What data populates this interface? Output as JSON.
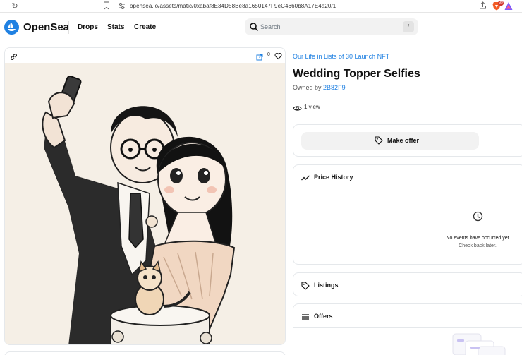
{
  "browser": {
    "url": "opensea.io/assets/matic/0xabaf8E34D58Be8a1650147F9eC4660b8A17E4a20/1",
    "extension_badge": "99",
    "icons": [
      "refresh-icon",
      "bookmark-icon",
      "site-settings-icon",
      "share-icon",
      "brave-icon",
      "alert-icon"
    ]
  },
  "header": {
    "logo_text": "OpenSea",
    "nav": {
      "drops": "Drops",
      "stats": "Stats",
      "create": "Create"
    },
    "search_placeholder": "Search",
    "search_shortcut": "/"
  },
  "media": {
    "favorite_count": "0",
    "icons": [
      "link-icon",
      "open-external-icon",
      "heart-icon"
    ]
  },
  "asset": {
    "collection": "Our Life in Lists of 30 Launch NFT",
    "title": "Wedding Topper Selfies",
    "owned_by_label": "Owned by",
    "owner": "2B82F9",
    "views": "1 view"
  },
  "offer": {
    "make_offer_label": "Make offer"
  },
  "price_history": {
    "label": "Price History",
    "empty_title": "No events have occurred yet",
    "empty_subtitle": "Check back later."
  },
  "listings": {
    "label": "Listings"
  },
  "offers": {
    "label": "Offers"
  },
  "colors": {
    "brand_blue": "#2081e2",
    "text": "#121212",
    "muted": "#707a83",
    "border": "#e5e8eb",
    "button_bg": "#f2f2f2"
  }
}
